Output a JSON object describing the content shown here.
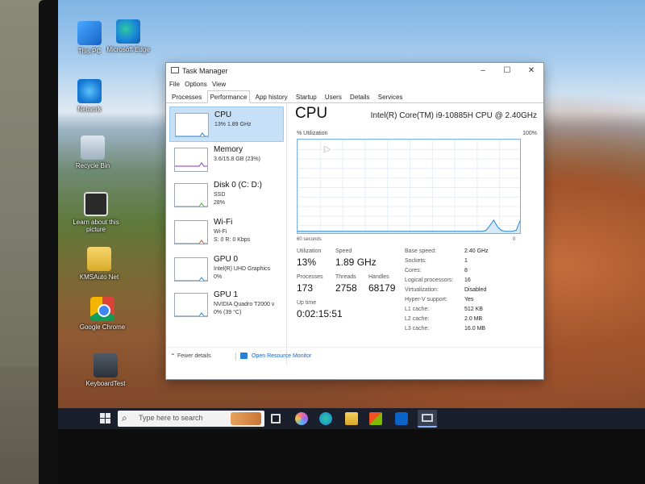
{
  "desktop": {
    "icons": [
      {
        "label": "This PC"
      },
      {
        "label": "Microsoft Edge"
      },
      {
        "label": "Network"
      },
      {
        "label": "Recycle Bin"
      },
      {
        "label": "Learn about this picture"
      },
      {
        "label": "KMSAuto Net"
      },
      {
        "label": "Google Chrome"
      },
      {
        "label": "KeyboardTest"
      }
    ]
  },
  "taskbar": {
    "search_placeholder": "Type here to search"
  },
  "window": {
    "title": "Task Manager",
    "controls": {
      "minimize": "–",
      "maximize": "☐",
      "close": "✕"
    },
    "menu": [
      "File",
      "Options",
      "View"
    ],
    "tabs": [
      "Processes",
      "Performance",
      "App history",
      "Startup",
      "Users",
      "Details",
      "Services"
    ],
    "active_tab": "Performance",
    "resources": [
      {
        "name": "CPU",
        "line2": "13%  1.89 GHz",
        "line3": "",
        "selected": true,
        "color": "#1e7fd8"
      },
      {
        "name": "Memory",
        "line2": "3.6/15.8 GB (23%)",
        "line3": "",
        "selected": false,
        "color": "#8b33b8"
      },
      {
        "name": "Disk 0 (C: D:)",
        "line2": "SSD",
        "line3": "28%",
        "selected": false,
        "color": "#4ca844"
      },
      {
        "name": "Wi-Fi",
        "line2": "Wi-Fi",
        "line3": "S: 0  R: 0 Kbps",
        "selected": false,
        "color": "#b05a2a"
      },
      {
        "name": "GPU 0",
        "line2": "Intel(R) UHD Graphics",
        "line3": "0%",
        "selected": false,
        "color": "#2a8ad8"
      },
      {
        "name": "GPU 1",
        "line2": "NVIDIA Quadro T2000 v",
        "line3": "0%  (39 °C)",
        "selected": false,
        "color": "#2a8ad8"
      }
    ],
    "cpu": {
      "title": "CPU",
      "model": "Intel(R) Core(TM) i9-10885H CPU @ 2.40GHz",
      "graph_label": "% Utilization",
      "graph_max": "100%",
      "graph_time": "60 seconds",
      "graph_min": "0",
      "utilization_label": "Utilization",
      "utilization": "13%",
      "speed_label": "Speed",
      "speed": "1.89 GHz",
      "processes_label": "Processes",
      "processes": "173",
      "threads_label": "Threads",
      "threads": "2758",
      "handles_label": "Handles",
      "handles": "68179",
      "uptime_label": "Up time",
      "uptime": "0:02:15:51",
      "details": [
        {
          "k": "Base speed:",
          "v": "2.40 GHz"
        },
        {
          "k": "Sockets:",
          "v": "1"
        },
        {
          "k": "Cores:",
          "v": "8"
        },
        {
          "k": "Logical processors:",
          "v": "16"
        },
        {
          "k": "Virtualization:",
          "v": "Disabled"
        },
        {
          "k": "Hyper-V support:",
          "v": "Yes"
        },
        {
          "k": "L1 cache:",
          "v": "512 KB"
        },
        {
          "k": "L2 cache:",
          "v": "2.0 MB"
        },
        {
          "k": "L3 cache:",
          "v": "16.0 MB"
        }
      ],
      "history": [
        2,
        2,
        2,
        2,
        2,
        2,
        2,
        2,
        2,
        2,
        2,
        2,
        2,
        2,
        2,
        2,
        2,
        2,
        2,
        2,
        2,
        2,
        2,
        2,
        2,
        2,
        2,
        2,
        2,
        2,
        2,
        2,
        2,
        2,
        2,
        2,
        2,
        2,
        2,
        2,
        2,
        2,
        2,
        2,
        2,
        2,
        2,
        2,
        2,
        2,
        3,
        8,
        14,
        7,
        3,
        2,
        2,
        2,
        3,
        13
      ]
    },
    "footer": {
      "fewer_details": "Fewer details",
      "open_monitor": "Open Resource Monitor"
    }
  }
}
